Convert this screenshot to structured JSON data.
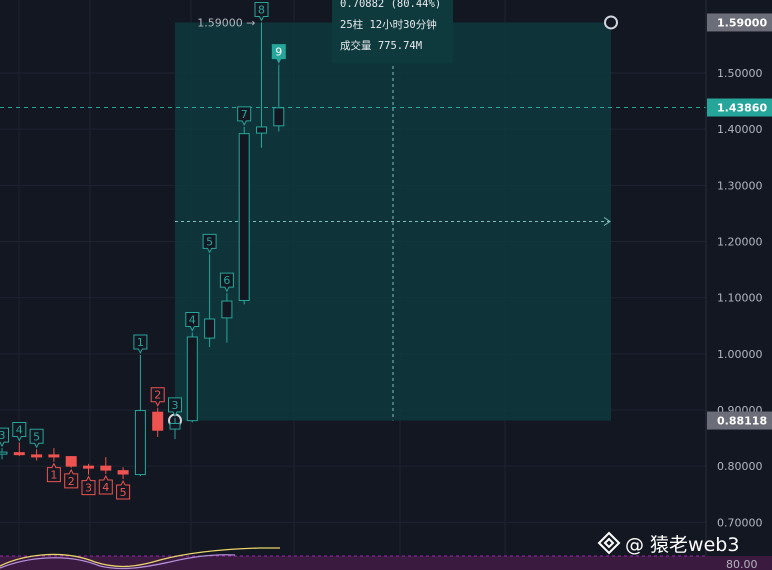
{
  "chart_data": {
    "type": "candlestick",
    "ylim": [
      0.64,
      1.63
    ],
    "y_ticks": [
      "0.70000",
      "0.80000",
      "0.90000",
      "1.00000",
      "1.10000",
      "1.20000",
      "1.30000",
      "1.40000",
      "1.50000"
    ],
    "price_badges": [
      {
        "label": "1.59000",
        "value": 1.59,
        "color": "#6b6e78"
      },
      {
        "label": "1.43860",
        "value": 1.4386,
        "color": "#26a69a"
      },
      {
        "label": "0.88118",
        "value": 0.88118,
        "color": "#6b6e78"
      }
    ],
    "bottom_axis_value": "80.00",
    "candles": [
      {
        "o": 0.822,
        "h": 0.832,
        "l": 0.812,
        "c": 0.825,
        "label": "3",
        "label_pos": "above",
        "label_color": "#26a69a"
      },
      {
        "o": 0.824,
        "h": 0.842,
        "l": 0.818,
        "c": 0.821,
        "label": "4",
        "label_pos": "above",
        "label_color": "#26a69a"
      },
      {
        "o": 0.82,
        "h": 0.83,
        "l": 0.81,
        "c": 0.818,
        "label": "5",
        "label_pos": "above",
        "label_color": "#26a69a"
      },
      {
        "o": 0.82,
        "h": 0.832,
        "l": 0.808,
        "c": 0.817,
        "label": "1",
        "label_pos": "below",
        "label_color": "#ef5350"
      },
      {
        "o": 0.817,
        "h": 0.818,
        "l": 0.797,
        "c": 0.8,
        "label": "2",
        "label_pos": "below",
        "label_color": "#ef5350"
      },
      {
        "o": 0.8,
        "h": 0.804,
        "l": 0.785,
        "c": 0.797,
        "label": "3",
        "label_pos": "below",
        "label_color": "#ef5350"
      },
      {
        "o": 0.8,
        "h": 0.816,
        "l": 0.786,
        "c": 0.793,
        "label": "4",
        "label_pos": "below",
        "label_color": "#ef5350"
      },
      {
        "o": 0.792,
        "h": 0.798,
        "l": 0.777,
        "c": 0.786,
        "label": "5",
        "label_pos": "below",
        "label_color": "#ef5350"
      },
      {
        "o": 0.785,
        "h": 0.998,
        "l": 0.782,
        "c": 0.899,
        "label": "1",
        "label_pos": "above",
        "label_color": "#26a69a"
      },
      {
        "o": 0.896,
        "h": 0.904,
        "l": 0.852,
        "c": 0.864,
        "label": "2",
        "label_pos": "above",
        "label_color": "#ef5350"
      },
      {
        "o": 0.866,
        "h": 0.886,
        "l": 0.848,
        "c": 0.876,
        "label": "3",
        "label_pos": "above",
        "label_color": "#26a69a"
      },
      {
        "o": 0.881,
        "h": 1.038,
        "l": 0.878,
        "c": 1.03,
        "label": "4",
        "label_pos": "above",
        "label_color": "#26a69a"
      },
      {
        "o": 1.028,
        "h": 1.177,
        "l": 1.012,
        "c": 1.062,
        "label": "5",
        "label_pos": "above",
        "label_color": "#26a69a"
      },
      {
        "o": 1.064,
        "h": 1.108,
        "l": 1.02,
        "c": 1.094,
        "label": "6",
        "label_pos": "above",
        "label_color": "#26a69a"
      },
      {
        "o": 1.095,
        "h": 1.404,
        "l": 1.088,
        "c": 1.392,
        "label": "7",
        "label_pos": "above",
        "label_color": "#26a69a"
      },
      {
        "o": 1.393,
        "h": 1.59,
        "l": 1.367,
        "c": 1.404,
        "label": "8",
        "label_pos": "above",
        "label_color": "#26a69a"
      },
      {
        "o": 1.406,
        "h": 1.515,
        "l": 1.396,
        "c": 1.438,
        "label": "9",
        "label_pos": "above",
        "label_color": "#26a69a",
        "label_filled": true
      }
    ],
    "measure_box": {
      "from_price": 0.88118,
      "to_price": 1.59,
      "change_text": "0.70882 (80.44%)",
      "bars_text": "25柱 12小时30分钟",
      "volume_text": "成交量 775.74M",
      "high_marker_label": "1.59000"
    },
    "colors": {
      "up": "#26a69a",
      "down": "#ef5350",
      "background": "#131722",
      "box_fill": "#0e3a3d"
    }
  },
  "watermark": {
    "text": "@ 猿老web3",
    "icon": "binance-square-icon"
  }
}
